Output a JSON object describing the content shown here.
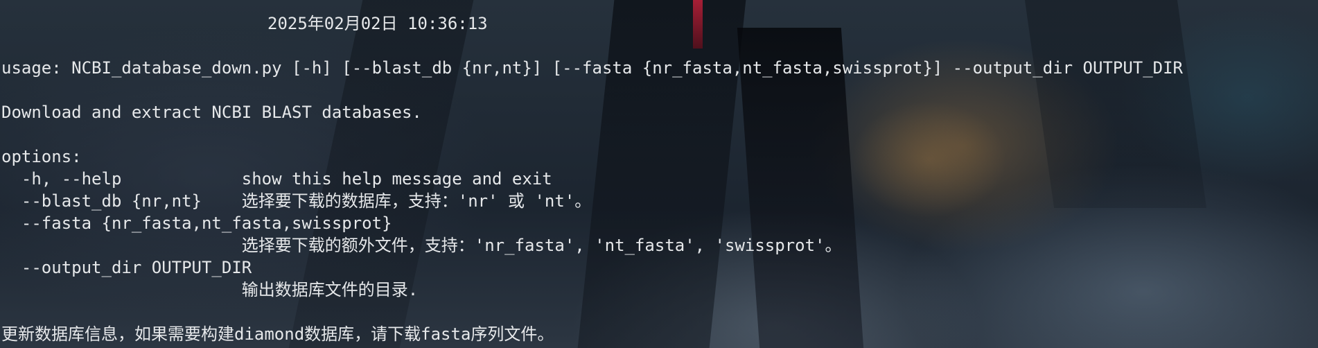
{
  "terminal": {
    "timestamp": "2025年02月02日 10:36:13",
    "usage": "usage: NCBI_database_down.py [-h] [--blast_db {nr,nt}] [--fasta {nr_fasta,nt_fasta,swissprot}] --output_dir OUTPUT_DIR",
    "description": "Download and extract NCBI BLAST databases.",
    "options_header": "options:",
    "opt_help": "  -h, --help            show this help message and exit",
    "opt_blast_db": "  --blast_db {nr,nt}    选择要下载的数据库，支持：'nr' 或 'nt'。",
    "opt_fasta": "  --fasta {nr_fasta,nt_fasta,swissprot}",
    "opt_fasta_desc": "                        选择要下载的额外文件，支持：'nr_fasta', 'nt_fasta', 'swissprot'。",
    "opt_output_dir": "  --output_dir OUTPUT_DIR",
    "opt_output_dir_desc": "                        输出数据库文件的目录.",
    "epilog": "更新数据库信息，如果需要构建diamond数据库，请下载fasta序列文件。"
  }
}
